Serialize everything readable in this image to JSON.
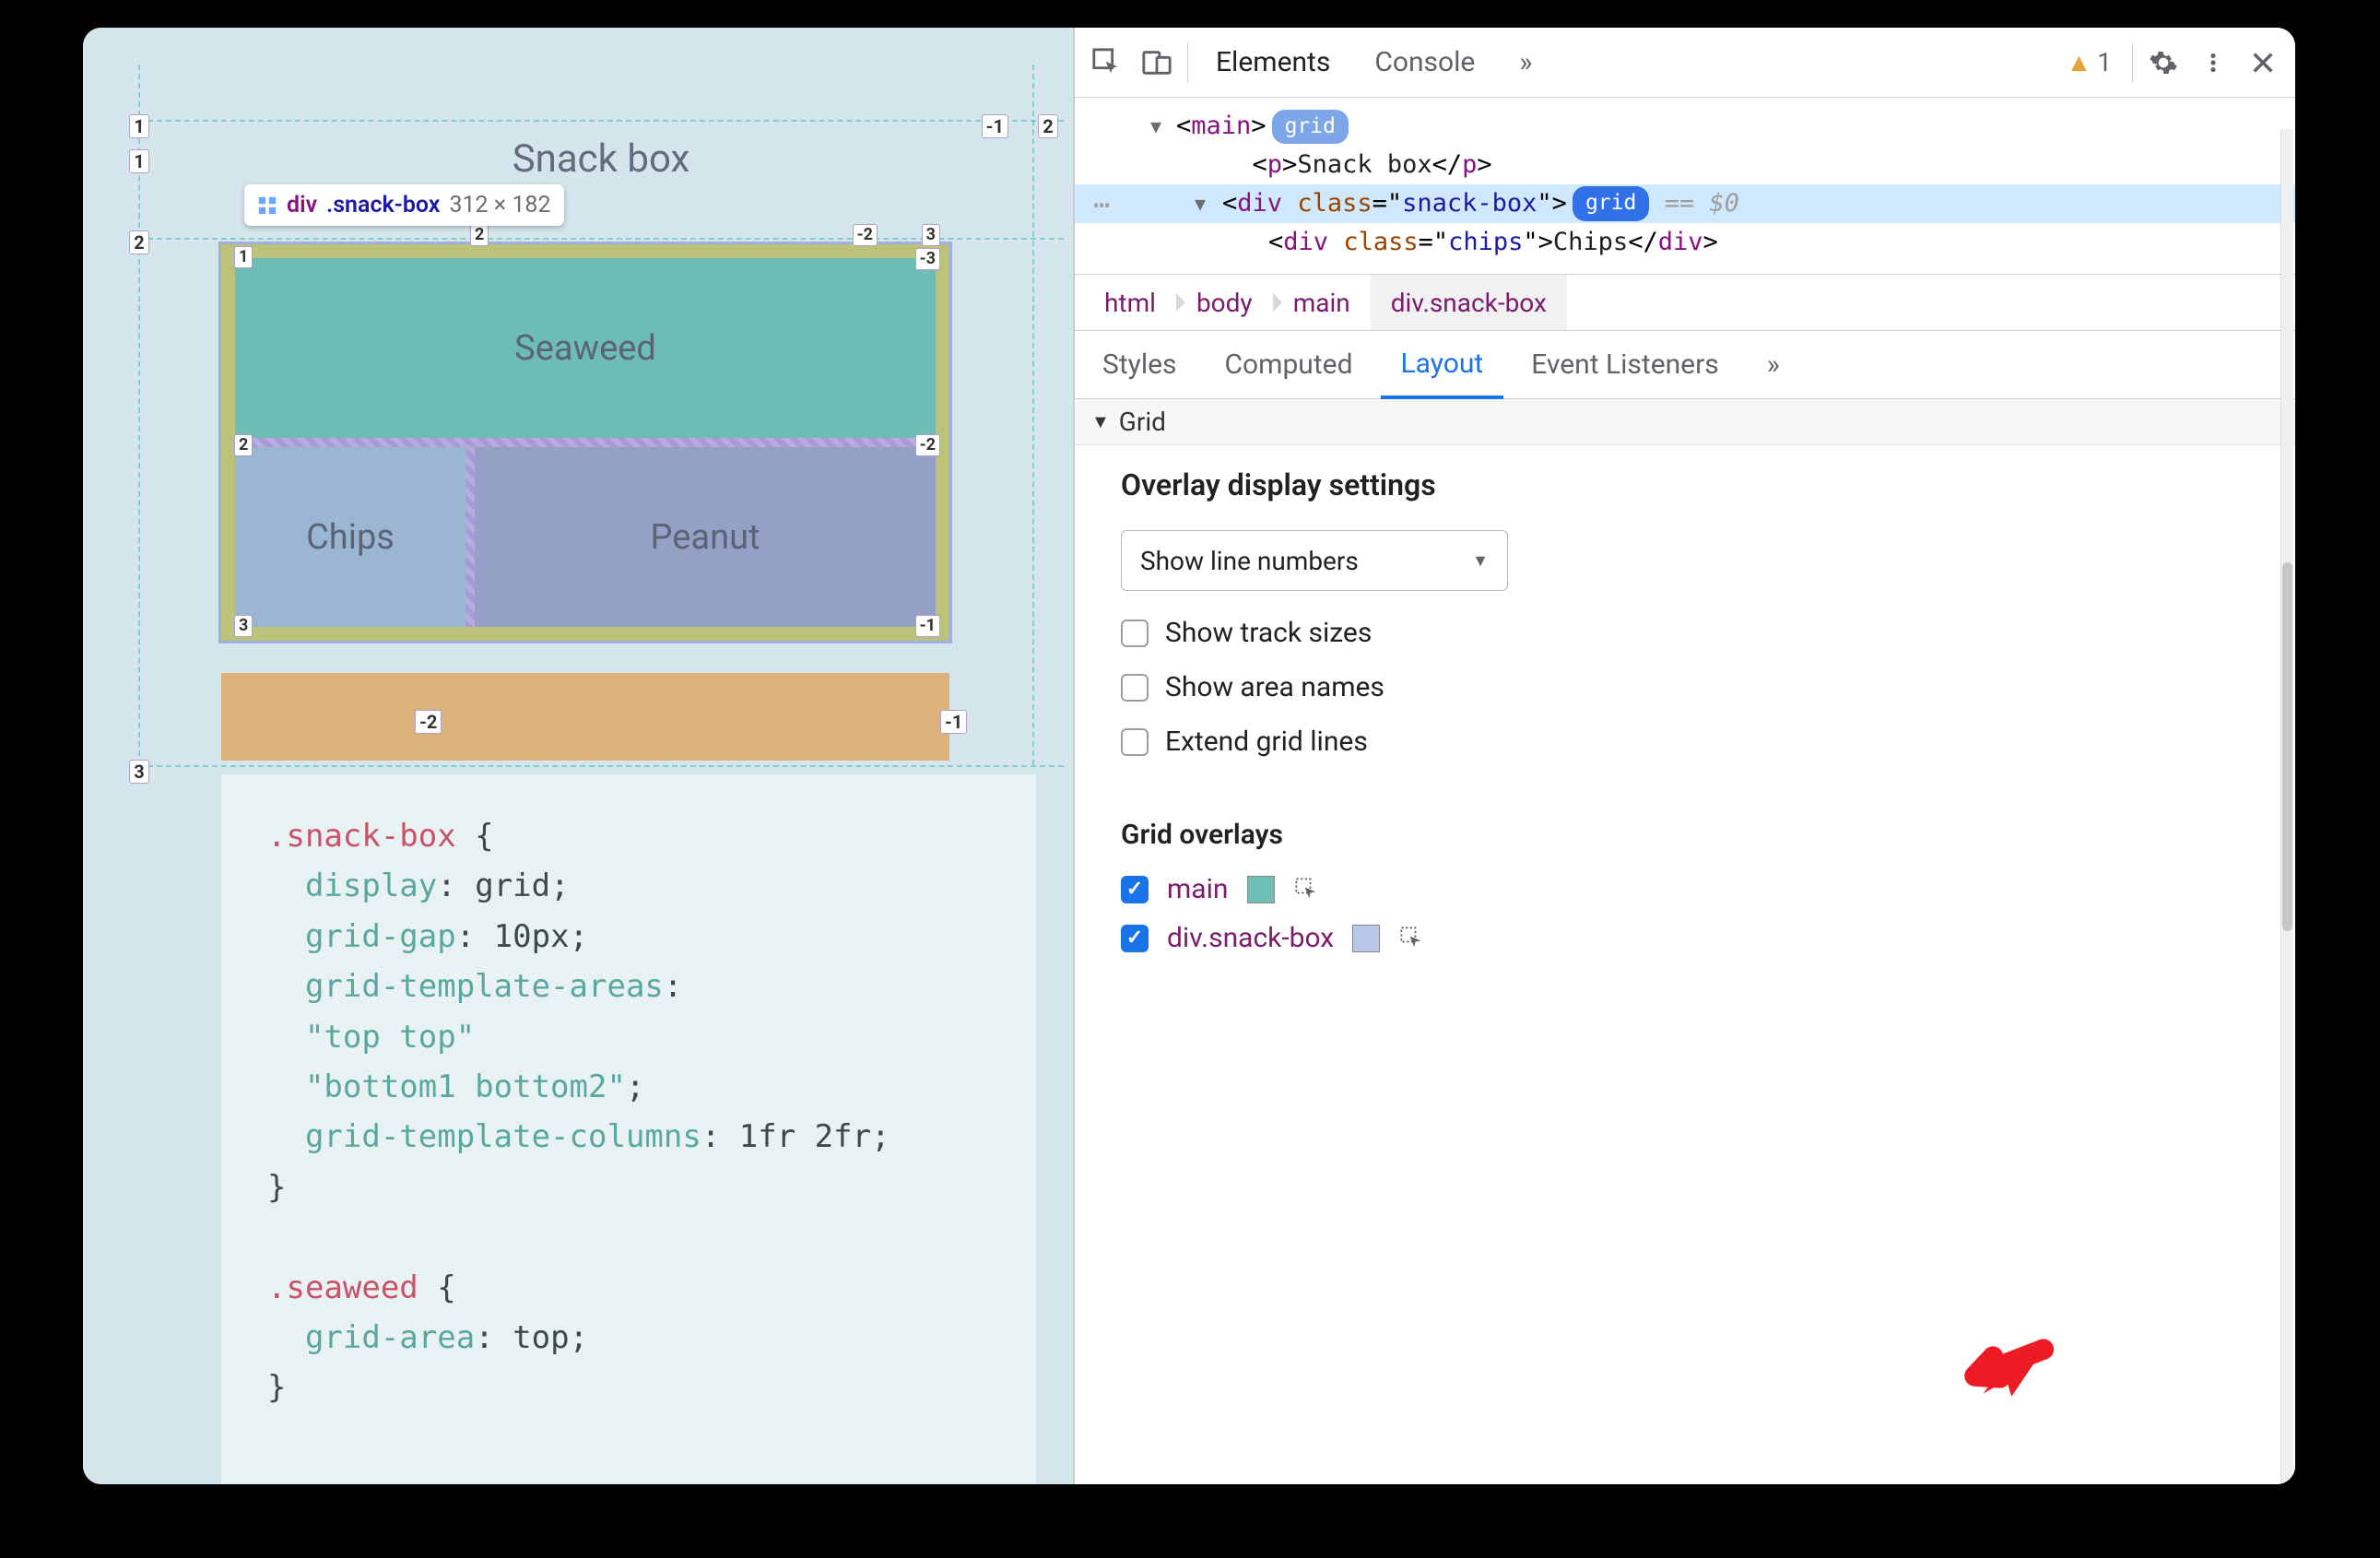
{
  "preview": {
    "title": "Snack box",
    "tooltip": {
      "tag": "div",
      "class": ".snack-box",
      "dims": "312 × 182"
    },
    "cells": {
      "seaweed": "Seaweed",
      "chips": "Chips",
      "peanut": "Peanut"
    },
    "outer_nums": {
      "top_left": "1",
      "top_right": "-1",
      "col_right": "2",
      "left_1": "1",
      "row_start": "2",
      "left_2_bottom": "3",
      "below_left": "-2",
      "below_right": "-1"
    },
    "inner_nums": {
      "r1_left_top": "1",
      "r1_right_top_a": "3",
      "r1_right_top_b": "-3",
      "r2_left": "2",
      "r2_mid": "2",
      "r2_right": "-2",
      "r3_left": "3",
      "r3_right": "-1",
      "col_top_mid": "-2"
    },
    "code": ".snack-box {\n  display: grid;\n  grid-gap: 10px;\n  grid-template-areas:\n  \"top top\"\n  \"bottom1 bottom2\";\n  grid-template-columns: 1fr 2fr;\n}\n\n.seaweed {\n  grid-area: top;\n}"
  },
  "devtools": {
    "tabs": {
      "elements": "Elements",
      "console": "Console"
    },
    "warning_count": "1",
    "dom": {
      "line1_tag": "main",
      "line1_badge": "grid",
      "line2_tag": "p",
      "line2_text": "Snack box",
      "line3_tag": "div",
      "line3_class": "snack-box",
      "line3_badge": "grid",
      "line3_suffix": " == $0",
      "line4_tag": "div",
      "line4_class": "chips",
      "line4_text": "Chips"
    },
    "breadcrumb": [
      "html",
      "body",
      "main",
      "div.snack-box"
    ],
    "style_tabs": {
      "styles": "Styles",
      "computed": "Computed",
      "layout": "Layout",
      "event": "Event Listeners"
    },
    "layout": {
      "section": "Grid",
      "settings_title": "Overlay display settings",
      "select": "Show line numbers",
      "checks": {
        "track": "Show track sizes",
        "area": "Show area names",
        "extend": "Extend grid lines"
      },
      "overlays_title": "Grid overlays",
      "overlays": {
        "main": "main",
        "snackbox": "div.snack-box"
      }
    }
  }
}
